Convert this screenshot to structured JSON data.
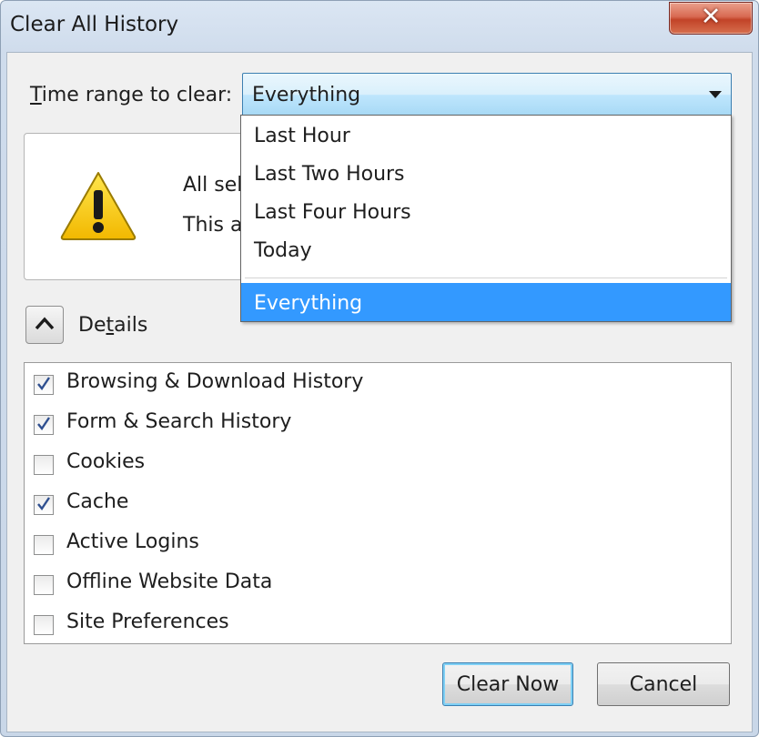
{
  "window": {
    "title": "Clear All History",
    "close_glyph": "✕"
  },
  "time_range": {
    "label": "ime range to clear:",
    "label_mnemonic": "T",
    "selected": "Everything",
    "options": [
      "Last Hour",
      "Last Two Hours",
      "Last Four Hours",
      "Today",
      "Everything"
    ]
  },
  "warning": {
    "icon": "warning-icon",
    "line1": "All sele",
    "line2": "This ac"
  },
  "details": {
    "label_pre": "De",
    "label_mnemonic": "t",
    "label_post": "ails",
    "expanded": true,
    "items": [
      {
        "label": "Browsing & Download History",
        "checked": true
      },
      {
        "label": "Form & Search History",
        "checked": true
      },
      {
        "label": "Cookies",
        "checked": false
      },
      {
        "label": "Cache",
        "checked": true
      },
      {
        "label": "Active Logins",
        "checked": false
      },
      {
        "label": "Offline Website Data",
        "checked": false
      },
      {
        "label": "Site Preferences",
        "checked": false
      }
    ]
  },
  "buttons": {
    "clear_now": "Clear Now",
    "cancel": "Cancel"
  },
  "colors": {
    "selection": "#3399ff",
    "check_mark": "#2f4f8f",
    "warning_yellow": "#f7d000"
  }
}
